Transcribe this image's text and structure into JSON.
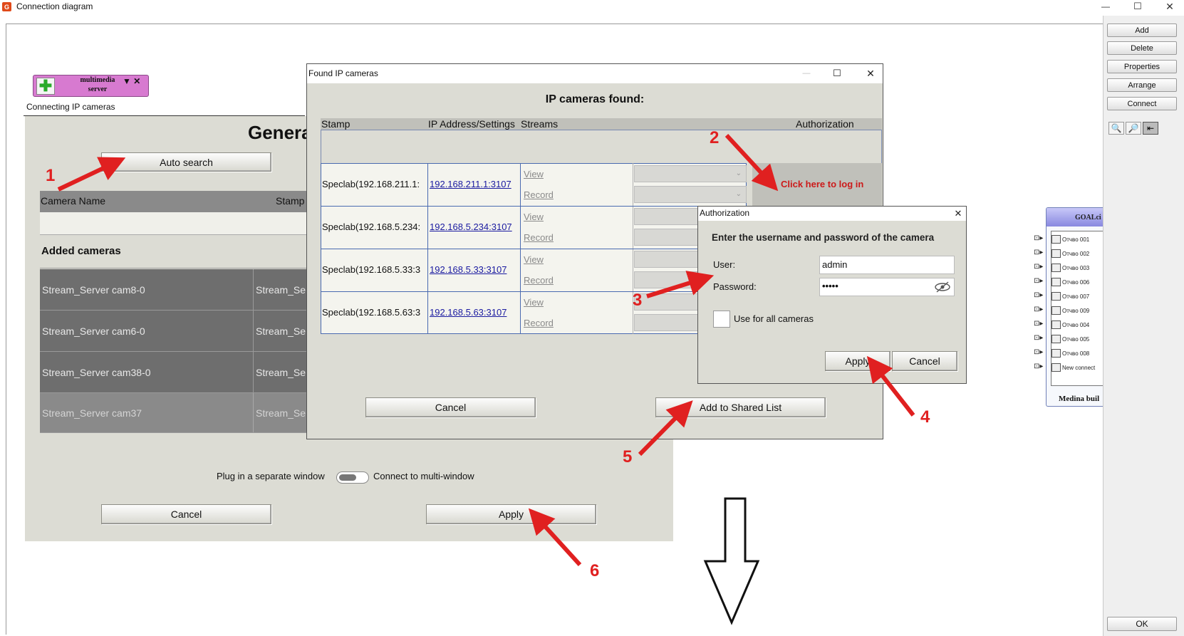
{
  "window": {
    "title": "Connection diagram",
    "controls": [
      "—",
      "☐",
      "✕"
    ]
  },
  "right_panel": {
    "buttons": [
      "Add",
      "Delete",
      "Properties",
      "Arrange",
      "Connect"
    ],
    "ok_label": "OK"
  },
  "server_node": {
    "label_line1": "multimedia",
    "label_line2": "server",
    "controls": "▼ ✕"
  },
  "connecting_dialog": {
    "caption": "Connecting IP cameras",
    "title": "Genera",
    "auto_search": "Auto search",
    "columns": [
      "Camera Name",
      "Stamp"
    ],
    "added_cameras_header": "Added cameras",
    "rows": [
      {
        "name": "Stream_Server cam8-0",
        "stamp": "Stream_Se"
      },
      {
        "name": "Stream_Server cam6-0",
        "stamp": "Stream_Se"
      },
      {
        "name": "Stream_Server cam38-0",
        "stamp": "Stream_Se"
      },
      {
        "name": "Stream_Server cam37",
        "stamp": "Stream_Se"
      }
    ],
    "toggle_left_label": "Plug in a separate window",
    "toggle_right_label": "Connect to multi-window",
    "cancel": "Cancel",
    "apply": "Apply"
  },
  "found_dialog": {
    "title": "Found IP cameras",
    "heading": "IP cameras found:",
    "columns": [
      "Stamp",
      "IP Address/Settings",
      "Streams",
      "Authorization"
    ],
    "cameras": [
      {
        "stamp": "Speclab(192.168.211.1:",
        "ip": "192.168.211.1:3107",
        "view": "View",
        "record": "Record"
      },
      {
        "stamp": "Speclab(192.168.5.234:",
        "ip": "192.168.5.234:3107",
        "view": "View",
        "record": "Record"
      },
      {
        "stamp": "Speclab(192.168.5.33:3",
        "ip": "192.168.5.33:3107",
        "view": "View",
        "record": "Record"
      },
      {
        "stamp": "Speclab(192.168.5.63:3",
        "ip": "192.168.5.63:3107",
        "view": "View",
        "record": "Record"
      }
    ],
    "login_prompt": "Click here to log in",
    "cancel": "Cancel",
    "add_shared": "Add to Shared List"
  },
  "auth_dialog": {
    "title": "Authorization",
    "heading": "Enter the username and password of the camera",
    "user_label": "User:",
    "user_value": "admin",
    "password_label": "Password:",
    "password_value": "•••••",
    "use_all_label": "Use for all cameras",
    "apply": "Apply",
    "cancel": "Cancel"
  },
  "goal_node": {
    "title": "GOALci",
    "items": [
      "Отчво 001",
      "Отчво 002",
      "Отчво 003",
      "Отчво 006",
      "Отчво 007",
      "Отчво 009",
      "Отчво 004",
      "Отчво 005",
      "Отчво 008",
      "New connect"
    ],
    "footer": "Medina buil"
  },
  "annotations": [
    "1",
    "2",
    "3",
    "4",
    "5",
    "6"
  ],
  "colors": {
    "annotation_red": "#e02020",
    "node_magenta": "#d77ad0",
    "dark_row": "#6e6e6e",
    "dialog_bg": "#dcdcd4"
  }
}
